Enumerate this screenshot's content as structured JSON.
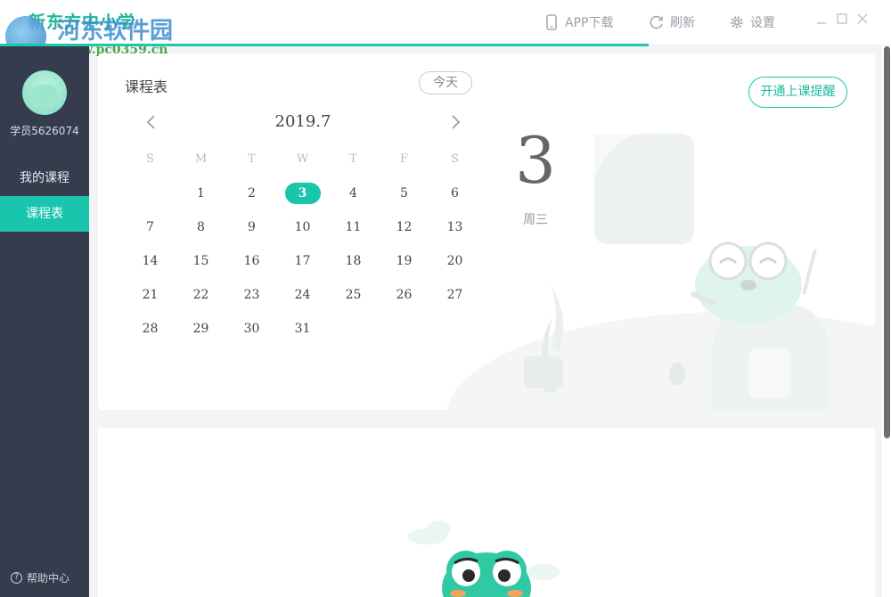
{
  "window": {
    "title": "新东方中小学",
    "watermark": {
      "name": "河东软件园",
      "url": "www.pc0359.cn"
    }
  },
  "toolbar": {
    "app_download": "APP下载",
    "refresh": "刷新",
    "settings": "设置"
  },
  "progress": 0.728,
  "user": {
    "name": "学员5626074"
  },
  "sidebar": {
    "items": [
      {
        "label": "我的课程",
        "active": false
      },
      {
        "label": "课程表",
        "active": true
      }
    ],
    "help": "帮助中心"
  },
  "schedule": {
    "title": "课程表",
    "today_button": "今天",
    "remind_button": "开通上课提醒",
    "month": "2019.7",
    "weekdays": [
      "S",
      "M",
      "T",
      "W",
      "T",
      "F",
      "S"
    ],
    "first_weekday_index": 1,
    "days_in_month": 31,
    "selected_day": 3,
    "big_date": "3",
    "big_weekday": "周三"
  },
  "colors": {
    "accent": "#19c6ad",
    "sidebar": "#353c4e",
    "titlebar": "#ffffff",
    "background": "#f3f4f6"
  }
}
